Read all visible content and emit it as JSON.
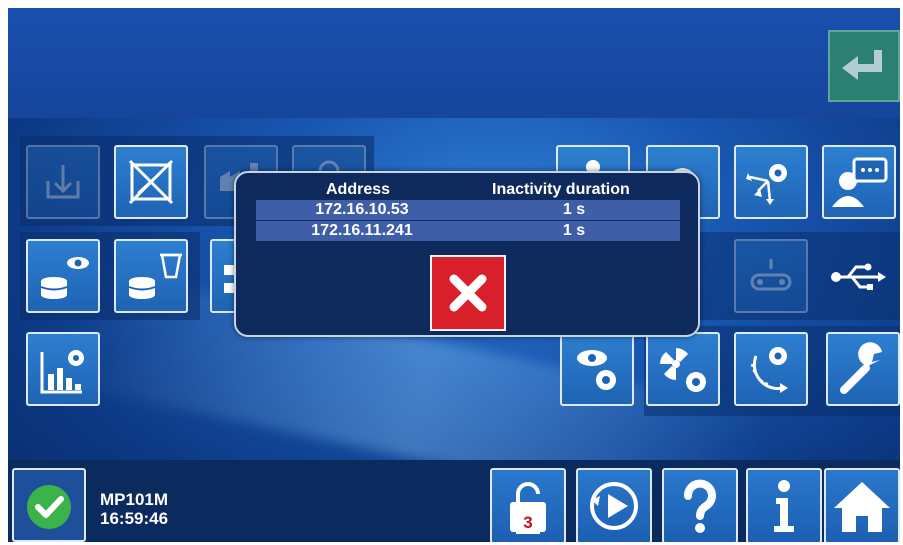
{
  "dialog": {
    "columns": [
      "Address",
      "Inactivity duration"
    ],
    "rows": [
      {
        "address": "172.16.10.53",
        "duration": "1 s"
      },
      {
        "address": "172.16.11.241",
        "duration": "1 s"
      }
    ]
  },
  "status": {
    "device": "MP101M",
    "time": "16:59:46",
    "lock_level": "3"
  },
  "icons": {
    "top_left_row1": [
      "download-icon",
      "no-box-icon",
      "factory-icon",
      "recycle-icon"
    ],
    "top_left_row2": [
      "view-database-icon",
      "database-delete-icon",
      "network-icon",
      "eye-icon",
      "power-icon"
    ],
    "top_left_row3": [
      "chart-settings-icon"
    ],
    "right_row1": [
      "gear-icon",
      "rotate-icon",
      "network-gear-icon",
      "user-chat-icon"
    ],
    "right_row2": [
      "conveyor-icon",
      "usb-icon"
    ],
    "right_row3": [
      "eye-gear-icon",
      "radiation-gear-icon",
      "rotate-gear-icon",
      "wrench-icon"
    ],
    "bottom": [
      "lock-icon",
      "play-icon",
      "help-icon",
      "info-icon",
      "home-icon"
    ]
  },
  "colors": {
    "accent": "#1f63b4",
    "close": "#d9202a",
    "ok": "#3cb34a",
    "enter": "#2f8a6b"
  }
}
